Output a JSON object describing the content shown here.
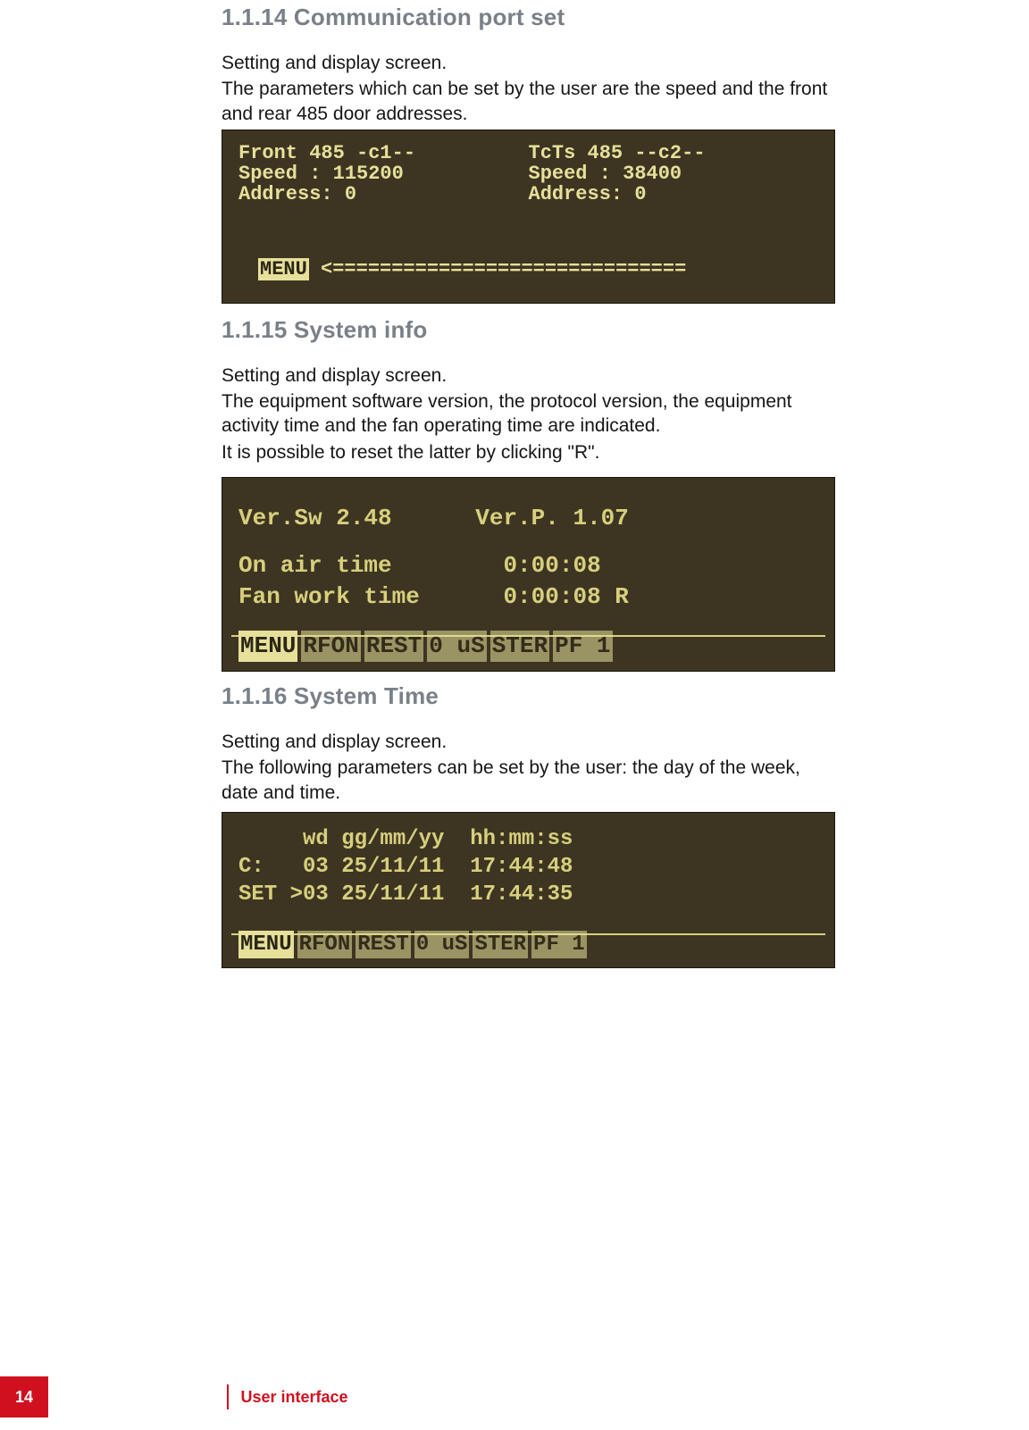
{
  "section_1_1_14": {
    "heading": "1.1.14 Communication port set",
    "para1": "Setting and display screen.",
    "para2": "The parameters which can be set by the user are the speed and the front and rear 485 door addresses."
  },
  "lcd1": {
    "left_title": "Front 485 -c1--",
    "left_speed": "Speed   : 115200",
    "left_addr": "Address:      0",
    "right_title": "TcTs 485 --c2--",
    "right_speed": "Speed   :  38400",
    "right_addr": "Address:      0",
    "menu_label": "MENU",
    "menu_line": "<=============================="
  },
  "section_1_1_15": {
    "heading": "1.1.15 System info",
    "para1": "Setting and display screen.",
    "para2": "The equipment software version, the protocol version, the equipment activity time and the fan operating time are indicated.",
    "para3": "It is possible to reset the latter by clicking \"R\"."
  },
  "lcd2": {
    "line1": "Ver.Sw 2.48      Ver.P. 1.07",
    "line2": "On air time        0:00:08",
    "line3": "Fan work time      0:00:08 R",
    "status_items": [
      "MENU",
      "RFON",
      "REST",
      "0  uS",
      "STER",
      "PF  1"
    ]
  },
  "section_1_1_16": {
    "heading": "1.1.16 System Time",
    "para1": "Setting and display screen.",
    "para2": "The following parameters can be set by the user: the day of the week, date and time."
  },
  "lcd3": {
    "header": "     wd gg/mm/yy  hh:mm:ss",
    "current": "C:   03 25/11/11  17:44:48",
    "set": "SET >03 25/11/11  17:44:35",
    "status_items": [
      "MENU",
      "RFON",
      "REST",
      "0  uS",
      "STER",
      "PF  1"
    ]
  },
  "footer": {
    "page_number": "14",
    "label": "User interface"
  }
}
